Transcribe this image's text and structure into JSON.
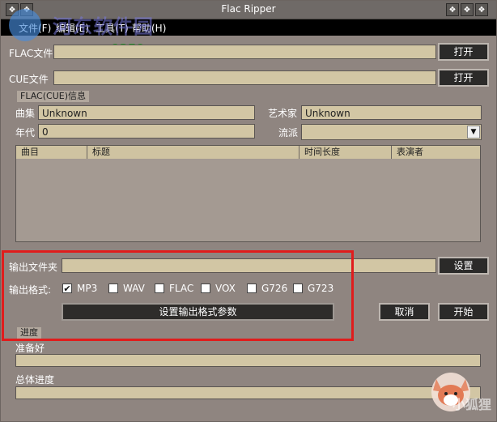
{
  "window": {
    "title": "Flac Ripper",
    "left_icons": [
      "❖",
      "❖"
    ],
    "right_icons": [
      "❖",
      "❖",
      "❖"
    ]
  },
  "menu": {
    "items": [
      "文件(F)",
      "编辑(E)",
      "工具(T)",
      "帮助(H)"
    ]
  },
  "watermark": {
    "site_cn": "河东软件园",
    "url": "www.pc0359.cn"
  },
  "file": {
    "flac_label": "FLAC文件",
    "flac_value": "",
    "cue_label": "CUE文件",
    "cue_value": "",
    "open_label_1": "打开",
    "open_label_2": "打开"
  },
  "info": {
    "group_title": "FLAC(CUE)信息",
    "album_label": "曲集",
    "album_value": "Unknown",
    "artist_label": "艺术家",
    "artist_value": "Unknown",
    "year_label": "年代",
    "year_value": "0",
    "genre_label": "流派",
    "genre_value": ""
  },
  "table": {
    "columns": [
      "曲目",
      "标题",
      "时间长度",
      "表演者"
    ],
    "rows": []
  },
  "output": {
    "folder_label": "输出文件夹",
    "folder_value": "",
    "settings_label": "设置",
    "format_label": "输出格式:",
    "formats": [
      {
        "name": "MP3",
        "checked": true
      },
      {
        "name": "WAV",
        "checked": false
      },
      {
        "name": "FLAC",
        "checked": false
      },
      {
        "name": "VOX",
        "checked": false
      },
      {
        "name": "G726",
        "checked": false
      },
      {
        "name": "G723",
        "checked": false
      }
    ],
    "format_params_label": "设置输出格式参数",
    "cancel_label": "取消",
    "start_label": "开始"
  },
  "progress": {
    "group_title": "进度",
    "status": "准备好",
    "current": 0,
    "total_label": "总体进度",
    "total": 0
  },
  "badge": {
    "text": "小狐狸"
  }
}
